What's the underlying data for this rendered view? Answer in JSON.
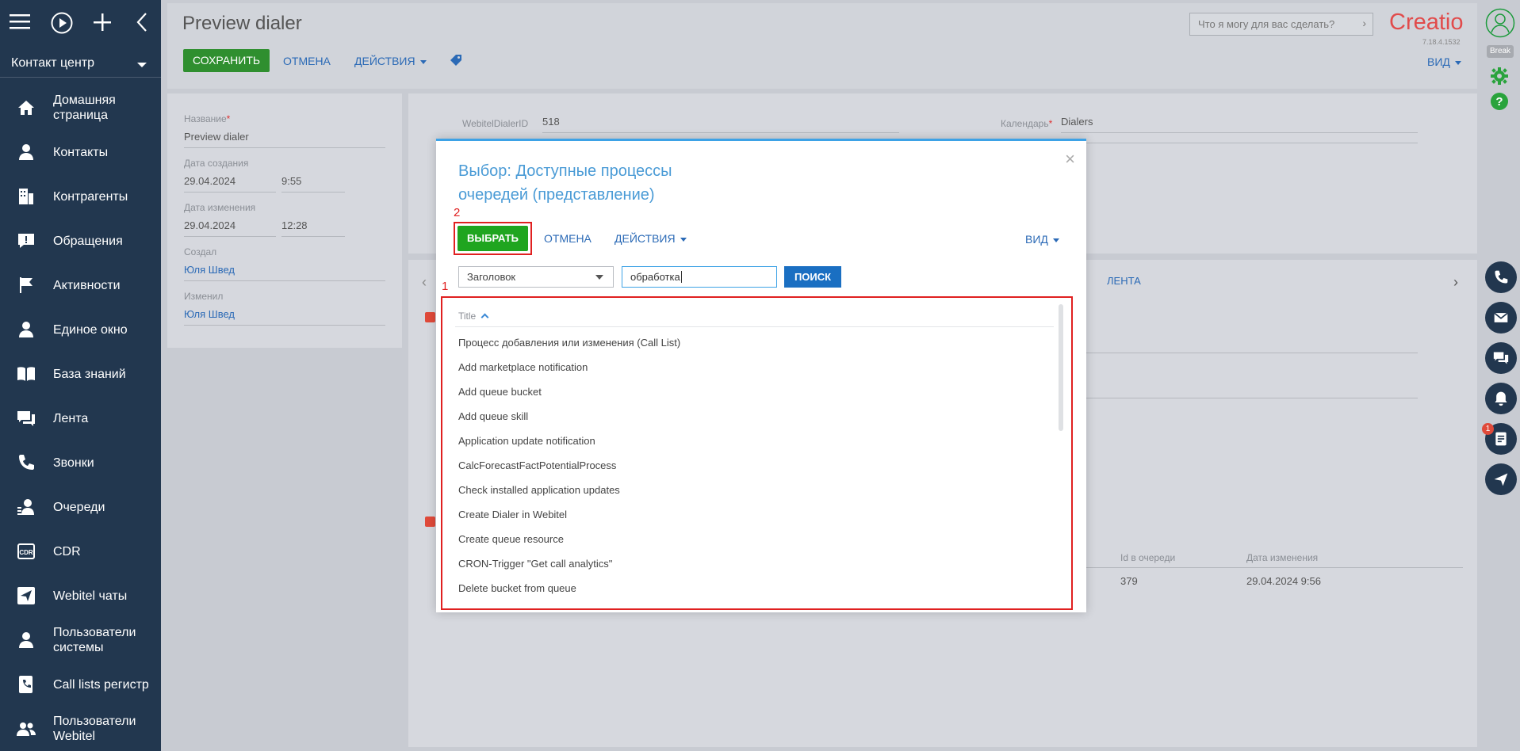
{
  "sidebar": {
    "workspace": "Контакт центр",
    "items": [
      {
        "label": "Домашняя страница",
        "icon": "home-icon"
      },
      {
        "label": "Контакты",
        "icon": "contact-icon"
      },
      {
        "label": "Контрагенты",
        "icon": "building-icon"
      },
      {
        "label": "Обращения",
        "icon": "case-icon"
      },
      {
        "label": "Активности",
        "icon": "flag-icon"
      },
      {
        "label": "Единое окно",
        "icon": "agent-icon"
      },
      {
        "label": "База знаний",
        "icon": "book-icon"
      },
      {
        "label": "Лента",
        "icon": "feed-icon"
      },
      {
        "label": "Звонки",
        "icon": "phone-icon"
      },
      {
        "label": "Очереди",
        "icon": "queue-icon"
      },
      {
        "label": "CDR",
        "icon": "cdr-icon"
      },
      {
        "label": "Webitel чаты",
        "icon": "send-icon"
      },
      {
        "label": "Пользователи системы",
        "icon": "user-icon"
      },
      {
        "label": "Call lists регистр",
        "icon": "calllist-icon"
      },
      {
        "label": "Пользователи Webitel",
        "icon": "users-icon"
      }
    ]
  },
  "header": {
    "title": "Preview dialer",
    "save": "СОХРАНИТЬ",
    "cancel": "ОТМЕНА",
    "actions": "ДЕЙСТВИЯ",
    "search_placeholder": "Что я могу для вас сделать?",
    "logo": "Creatio",
    "version": "7.18.4.1532",
    "view": "ВИД",
    "status": "Break"
  },
  "left_panel": {
    "name_label": "Название",
    "name_value": "Preview dialer",
    "created_label": "Дата создания",
    "created_date": "29.04.2024",
    "created_time": "9:55",
    "modified_label": "Дата изменения",
    "modified_date": "29.04.2024",
    "modified_time": "12:28",
    "created_by_label": "Создал",
    "created_by": "Юля Швед",
    "modified_by_label": "Изменил",
    "modified_by": "Юля Швед"
  },
  "right_panel": {
    "dialer_id_label": "WebitelDialerID",
    "dialer_id": "518",
    "calendar_label": "Календарь",
    "calendar": "Dialers",
    "feed_tab": "ЛЕНТА",
    "col_queue_id": "Id в очереди",
    "col_modified": "Дата изменения",
    "row_queue_id": "379",
    "row_modified": "29.04.2024 9:56"
  },
  "modal": {
    "title": "Выбор: Доступные процессы очередей (представление)",
    "select": "ВЫБРАТЬ",
    "cancel": "ОТМЕНА",
    "actions": "ДЕЙСТВИЯ",
    "view": "ВИД",
    "filter_column": "Заголовок",
    "search_value": "обработка",
    "search_btn": "ПОИСК",
    "annotation_1": "1",
    "annotation_2": "2",
    "column": "Title",
    "rows": [
      "Процесс добавления или изменения (Call List)",
      "Add marketplace notification",
      "Add queue bucket",
      "Add queue skill",
      "Application update notification",
      "CalcForecastFactPotentialProcess",
      "Check installed application updates",
      "Create Dialer in Webitel",
      "Create queue resource",
      "CRON-Trigger \"Get call analytics\"",
      "Delete bucket from queue"
    ]
  },
  "colors": {
    "sidebar": "#22374f",
    "select_button": "#1fa51f",
    "search_button": "#1a6fc2",
    "annotation": "#e02020"
  }
}
